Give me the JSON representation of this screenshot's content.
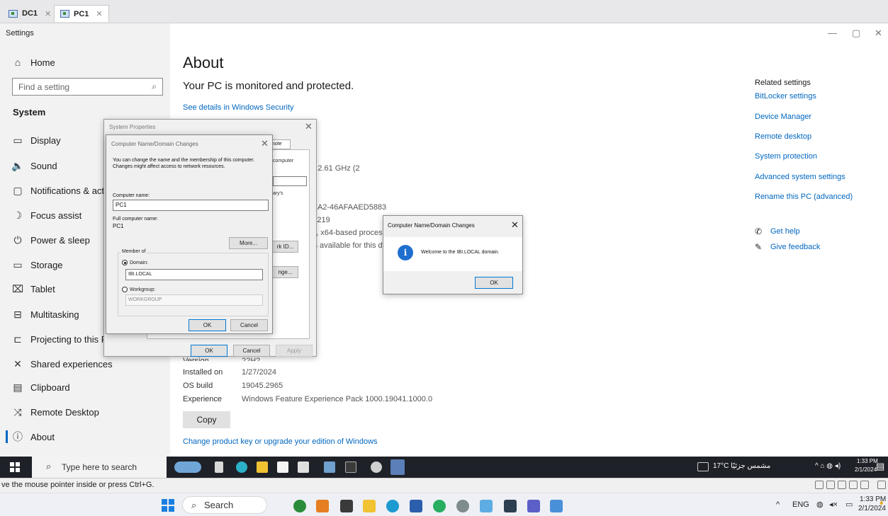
{
  "vm_tabs": [
    {
      "label": "DC1",
      "active": false
    },
    {
      "label": "PC1",
      "active": true
    }
  ],
  "settings": {
    "window_title": "Settings",
    "win_controls": {
      "minimize": "—",
      "restore": "▢",
      "close": "✕"
    },
    "home_label": "Home",
    "search_placeholder": "Find a setting",
    "system_label": "System",
    "nav_items": [
      {
        "label": "Display",
        "icon": "monitor-icon",
        "glyph": "▭"
      },
      {
        "label": "Sound",
        "icon": "speaker-icon",
        "glyph": "🔈"
      },
      {
        "label": "Notifications & actions",
        "icon": "notification-icon",
        "glyph": "▢"
      },
      {
        "label": "Focus assist",
        "icon": "moon-icon",
        "glyph": "☽"
      },
      {
        "label": "Power & sleep",
        "icon": "power-icon",
        "glyph": "⏻"
      },
      {
        "label": "Storage",
        "icon": "storage-icon",
        "glyph": "▭"
      },
      {
        "label": "Tablet",
        "icon": "tablet-icon",
        "glyph": "⌧"
      },
      {
        "label": "Multitasking",
        "icon": "multitasking-icon",
        "glyph": "⊟"
      },
      {
        "label": "Projecting to this PC",
        "icon": "projecting-icon",
        "glyph": "⊏"
      },
      {
        "label": "Shared experiences",
        "icon": "shared-experiences-icon",
        "glyph": "✕"
      },
      {
        "label": "Clipboard",
        "icon": "clipboard-icon",
        "glyph": "▤"
      },
      {
        "label": "Remote Desktop",
        "icon": "remote-desktop-icon",
        "glyph": "⤨"
      },
      {
        "label": "About",
        "icon": "info-icon",
        "glyph": "ⓘ"
      }
    ],
    "about": {
      "title": "About",
      "protected": "Your PC is monitored and protected.",
      "security_link": "See details in Windows Security",
      "spec_fragments": {
        "processor": "TM) i7-1255U   2.61 GHz  (2",
        "device_id": "CA2-46AFAAED5883",
        "product_id": "A219",
        "system_type": "n, x64-based processo",
        "pen_touch": "is available for this di"
      },
      "version_label": "Version",
      "version_value": "22H2",
      "windows_specs": [
        {
          "label": "Installed on",
          "value": "1/27/2024"
        },
        {
          "label": "OS build",
          "value": "19045.2965"
        },
        {
          "label": "Experience",
          "value": "Windows Feature Experience Pack 1000.19041.1000.0"
        }
      ],
      "copy_label": "Copy",
      "product_link": "Change product key or upgrade your edition of Windows"
    },
    "related": {
      "heading": "Related settings",
      "links": [
        "BitLocker settings",
        "Device Manager",
        "Remote desktop",
        "System protection",
        "Advanced system settings",
        "Rename this PC (advanced)"
      ],
      "help": "Get help",
      "feedback": "Give feedback"
    }
  },
  "system_properties": {
    "title": "System Properties",
    "tab_fragment": "mote",
    "frag_computer": "computer",
    "frag_arys": "ary's",
    "frag_network_id": "rk ID...",
    "frag_change": "nge...",
    "ok": "OK",
    "cancel": "Cancel",
    "apply": "Apply"
  },
  "computer_name_dialog": {
    "title": "Computer Name/Domain Changes",
    "description": "You can change the name and the membership of this computer. Changes might affect access to network resources.",
    "computer_name_label": "Computer name:",
    "computer_name_value": "PC1",
    "full_name_label": "Full computer name:",
    "full_name_value": "PC1",
    "more_button": "More...",
    "member_of": "Member of",
    "domain_label": "Domain:",
    "domain_value": "IBI.LOCAL",
    "workgroup_label": "Workgroup:",
    "workgroup_value": "WORKGROUP",
    "ok": "OK",
    "cancel": "Cancel"
  },
  "welcome_dialog": {
    "title": "Computer Name/Domain Changes",
    "message": "Welcome to the IBI.LOCAL domain.",
    "ok": "OK"
  },
  "taskbar_vm": {
    "search_placeholder": "Type here to search",
    "weather": "17°C  مشمس جزئيًا",
    "time": "1:33 PM",
    "date": "2/1/2024"
  },
  "vm_status": {
    "text": "ve the mouse pointer inside or press Ctrl+G."
  },
  "taskbar_host": {
    "search_label": "Search",
    "lang": "ENG",
    "time": "1:33 PM",
    "date": "2/1/2024"
  },
  "colors": {
    "accent": "#0067c0",
    "taskbar_dark": "#1f2128",
    "sidebar_bg": "#f2f2f2"
  }
}
